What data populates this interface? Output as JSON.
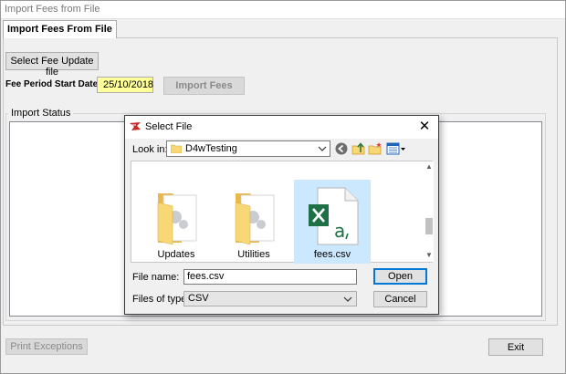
{
  "window": {
    "title": "Import Fees from File"
  },
  "tab": {
    "label": "Import Fees From File"
  },
  "controls": {
    "select_file_button": "Select Fee Update file",
    "fee_period_label": "Fee Period Start Date",
    "fee_period_value": "25/10/2018",
    "import_button": "Import Fees",
    "import_status_label": "Import Status",
    "print_exceptions_button": "Print Exceptions",
    "exit_button": "Exit"
  },
  "dialog": {
    "title": "Select File",
    "look_in_label": "Look in:",
    "look_in_value": "D4wTesting",
    "files": [
      {
        "name": "Updates",
        "icon": "folder-icon",
        "selected": false
      },
      {
        "name": "Utilities",
        "icon": "folder-icon",
        "selected": false
      },
      {
        "name": "fees.csv",
        "icon": "excel-csv-icon",
        "selected": true
      }
    ],
    "file_name_label": "File name:",
    "file_name_value": "fees.csv",
    "files_of_type_label": "Files of type:",
    "files_of_type_value": "CSV",
    "open_button": "Open",
    "cancel_button": "Cancel",
    "toolbar_icons": [
      "back-icon",
      "up-folder-icon",
      "new-folder-icon",
      "view-menu-icon"
    ]
  },
  "colors": {
    "date_field_bg": "#ffff99",
    "selection": "#cce8ff",
    "excel_green": "#1e7145",
    "folder_yellow": "#f8d775"
  }
}
